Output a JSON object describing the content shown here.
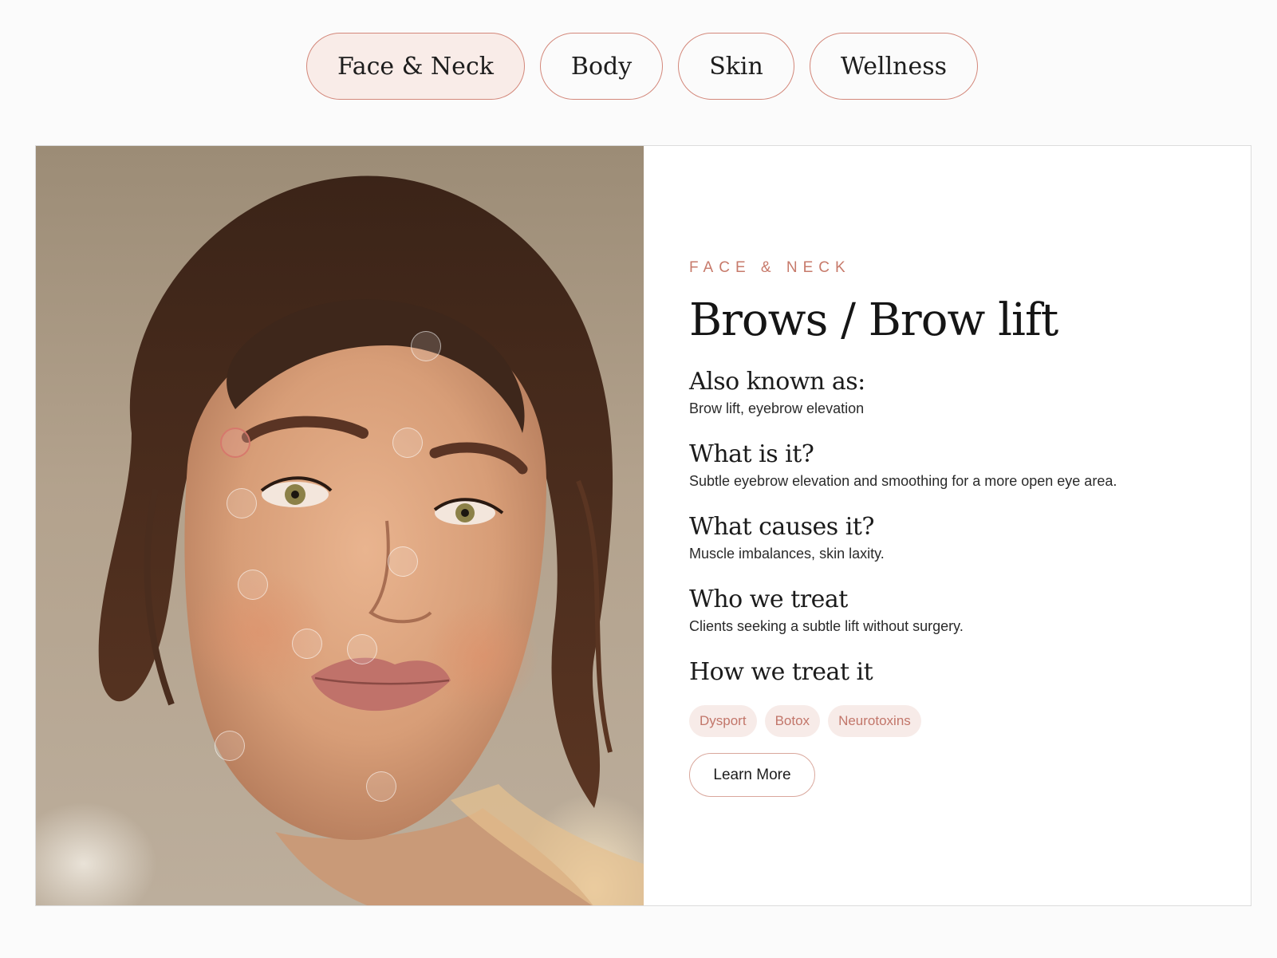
{
  "tabs": [
    {
      "label": "Face & Neck",
      "active": true
    },
    {
      "label": "Body",
      "active": false
    },
    {
      "label": "Skin",
      "active": false
    },
    {
      "label": "Wellness",
      "active": false
    }
  ],
  "detail": {
    "category": "FACE & NECK",
    "title": "Brows / Brow lift",
    "sections": [
      {
        "heading": "Also known as:",
        "text": "Brow lift, eyebrow elevation"
      },
      {
        "heading": "What is it?",
        "text": "Subtle eyebrow elevation and smoothing for a more open eye area."
      },
      {
        "heading": "What causes it?",
        "text": "Muscle imbalances, skin laxity."
      },
      {
        "heading": "Who we treat",
        "text": "Clients seeking a subtle lift without surgery."
      },
      {
        "heading": "How we treat it",
        "text": ""
      }
    ],
    "treatments": [
      "Dysport",
      "Botox",
      "Neurotoxins"
    ],
    "cta_label": "Learn More"
  },
  "image": {
    "description": "portrait-photo",
    "hotspot_count": 10,
    "active_hotspot_index": 1
  },
  "colors": {
    "accent": "#c77a6b",
    "tab_border": "#d3877a",
    "tab_active_bg": "#f9ece8",
    "pill_bg": "#f7ebe8"
  }
}
